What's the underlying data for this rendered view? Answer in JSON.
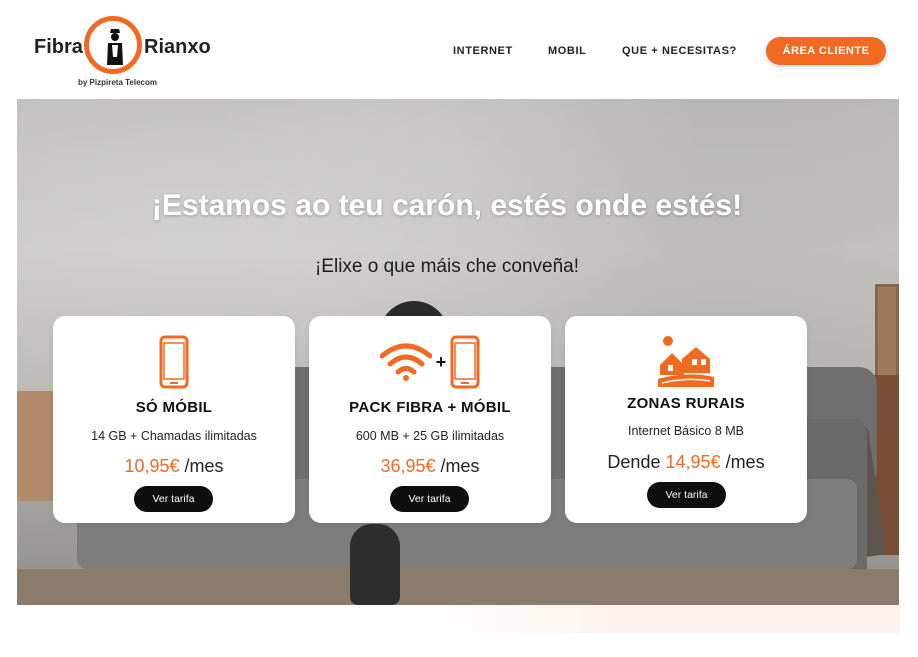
{
  "header": {
    "logo_word_left": "Fibra",
    "logo_word_right": "Rianxo",
    "logo_tagline": "by Pizpireta Telecom",
    "nav": [
      {
        "label": "INTERNET"
      },
      {
        "label": "MOBIL"
      },
      {
        "label": "QUE + NECESITAS?"
      }
    ],
    "cta_label": "ÁREA CLIENTE"
  },
  "hero": {
    "title": "¡Estamos ao teu carón, estés onde estés!",
    "subtitle": "¡Elixe o que máis che conveña!"
  },
  "cards": [
    {
      "icon": "mobile-phone-icon",
      "title": "SÓ MÓBIL",
      "description": "14 GB + Chamadas ilimitadas",
      "price_prefix": "",
      "price": "10,95€",
      "price_suffix": "/mes",
      "button": "Ver tarifa"
    },
    {
      "icon": "wifi-plus-mobile-icon",
      "icon_plus": "+",
      "title": "PACK FIBRA + MÓBIL",
      "description": "600 MB + 25 GB ilimitadas",
      "price_prefix": "",
      "price": "36,95€",
      "price_suffix": "/mes",
      "button": "Ver tarifa"
    },
    {
      "icon": "rural-houses-icon",
      "title": "ZONAS RURAIS",
      "description": "Internet Básico 8 MB",
      "price_prefix": "Dende",
      "price": "14,95€",
      "price_suffix": "/mes",
      "button": "Ver tarifa"
    }
  ],
  "colors": {
    "accent": "#f26a21",
    "button_dark": "#0e0e0e",
    "card_bg": "#ffffff"
  }
}
